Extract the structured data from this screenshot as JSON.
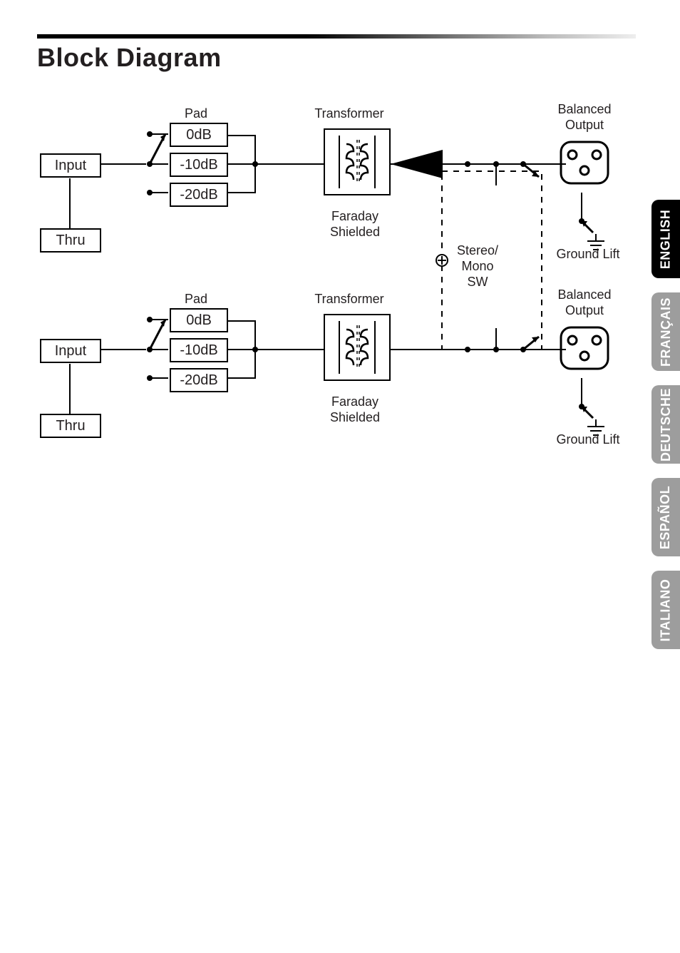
{
  "title": "Block Diagram",
  "languages": [
    "ENGLISH",
    "FRANÇAIS",
    "DEUTSCHE",
    "ESPAÑOL",
    "ITALIANO"
  ],
  "channel": {
    "input": "Input",
    "thru": "Thru",
    "padLabel": "Pad",
    "padOptions": [
      "0dB",
      "-10dB",
      "-20dB"
    ],
    "transformerLabel": "Transformer",
    "shieldLabel": "Faraday\nShielded",
    "outputLabel": "Balanced\nOutput",
    "groundLift": "Ground Lift"
  },
  "stereoMono": "Stereo/\nMono\nSW"
}
